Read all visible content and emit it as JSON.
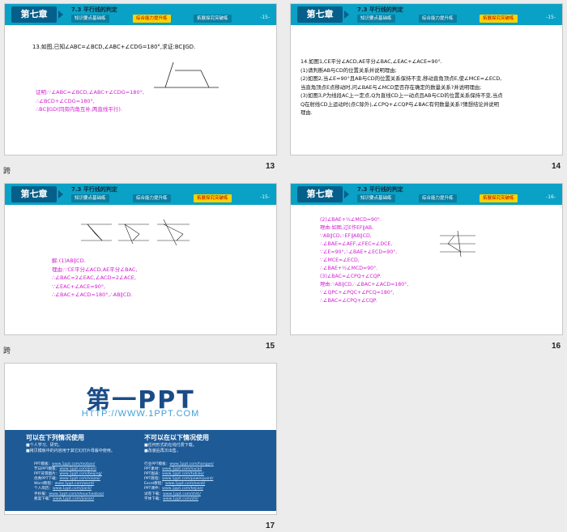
{
  "header": {
    "chapter": "第七章",
    "section": "7.3 平行线的判定",
    "tabs": [
      "知识要点基础练",
      "综合能力提升练",
      "拓展探究突破练"
    ]
  },
  "slides": [
    {
      "number": "13",
      "active_tab": 1,
      "page_label": "-15-",
      "problem": "13.如图,已知∠ABC=∠BCD,∠ABC+∠CDG=180°,求证:BC∥GD.",
      "solution": [
        "证明:∵∠ABC=∠BCD,∠ABC+∠CDG=180°,",
        "∴∠BCD+∠CDG=180°,",
        "∴BC∥GD(同旁内角互补,两直线平行)."
      ]
    },
    {
      "number": "14",
      "active_tab": 2,
      "page_label": "-15-",
      "problem": [
        "14.如图1,CE平分∠ACD,AE平分∠BAC,∠EAC+∠ACE=90°.",
        "(1)请判断AB与CD的位置关系并说明理由;",
        "(2)如图2,当∠E=90°且AB与CD的位置关系保持不变,移动直角顶点E,使∠MCE=∠ECD,",
        "当直角顶点E点移动时,问∠BAE与∠MCD是否存在确定的数量关系?并说明理由;",
        "(3)如图3,P为线段AC上一定点,Q为直线CD上一动点且AB与CD的位置关系保持不变,当点",
        "Q在射线CD上运动时(点C除外),∠CPQ+∠CQP与∠BAC有何数量关系?猜想结论并说明",
        "理由."
      ]
    },
    {
      "number": "15",
      "active_tab": 2,
      "page_label": "-15-",
      "solution": [
        "解:(1)AB∥CD.",
        "理由:∵CE平分∠ACD,AE平分∠BAC,",
        "∴∠BAC=2∠EAC,∠ACD=2∠ACE,",
        "∵∠EAC+∠ACE=90°,",
        "∴∠BAC+∠ACD=180°,∴AB∥CD."
      ]
    },
    {
      "number": "16",
      "active_tab": 2,
      "page_label": "-16-",
      "solution": [
        "(2)∠BAE+½∠MCD=90°.",
        "理由:如图,过E作EF∥AB,",
        "∵AB∥CD,∴EF∥AB∥CD,",
        "∴∠BAE=∠AEF,∠FEC=∠DCE,",
        "∵∠E=90°,∴∠BAE+∠ECD=90°,",
        "∵∠MCE=∠ECD,",
        "∴∠BAE+½∠MCD=90°.",
        "(3)∠BAC=∠CPQ+∠CQP.",
        "理由:∵AB∥CD,∴∠BAC+∠ACD=180°,",
        "∵∠QPC+∠PQC+∠PCQ=180°,",
        "∴∠BAC=∠CPQ+∠CQP."
      ]
    },
    {
      "number": "17",
      "logo": "第一PPT",
      "url": "HTTP://WWW.1PPT.COM",
      "left_heading": "可以在下列情况使用",
      "left_items": [
        "■个人学习、研究。",
        "■拷贝模板中的内容用于其它幻灯片母版中使用。"
      ],
      "right_heading": "不可以在以下情况使用",
      "right_items": [
        "■任何形式的在线付费下载。",
        "■改装后再次出售。"
      ],
      "left_links": [
        [
          "PPT模板：",
          "www.1ppt.com/moban/"
        ],
        [
          "节日PPT模板：",
          "www.1ppt.com/jieri/"
        ],
        [
          "PPT背景图片：",
          "www.1ppt.com/beijing/"
        ],
        [
          "优秀PPT下载：",
          "www.1ppt.com/xiazai/"
        ],
        [
          "Word教程：",
          "www.1ppt.com/word/"
        ],
        [
          "个人简历：",
          "www.1ppt.com/jianli/"
        ],
        [
          "手抄报：",
          "www.1ppt.com/shouchaobao/"
        ],
        [
          "教案下载：",
          "www.1ppt.com/jiaoan/"
        ]
      ],
      "right_links": [
        [
          "行业PPT模板：",
          "www.1ppt.com/hangye/"
        ],
        [
          "PPT素材：",
          "www.1ppt.com/sucai/"
        ],
        [
          "PPT图表：",
          "www.1ppt.com/tubiao/"
        ],
        [
          "PPT教程：",
          "www.1ppt.com/powerpoint/"
        ],
        [
          "Excel教程：",
          "www.1ppt.com/excel/"
        ],
        [
          "PPT课件：",
          "www.1ppt.com/kejian/"
        ],
        [
          "试卷下载：",
          "www.1ppt.com/shiti/"
        ],
        [
          "字体下载：",
          "www.1ppt.com/ziti/"
        ]
      ]
    }
  ],
  "cut_marks": [
    "跨",
    "跨",
    "跨"
  ]
}
